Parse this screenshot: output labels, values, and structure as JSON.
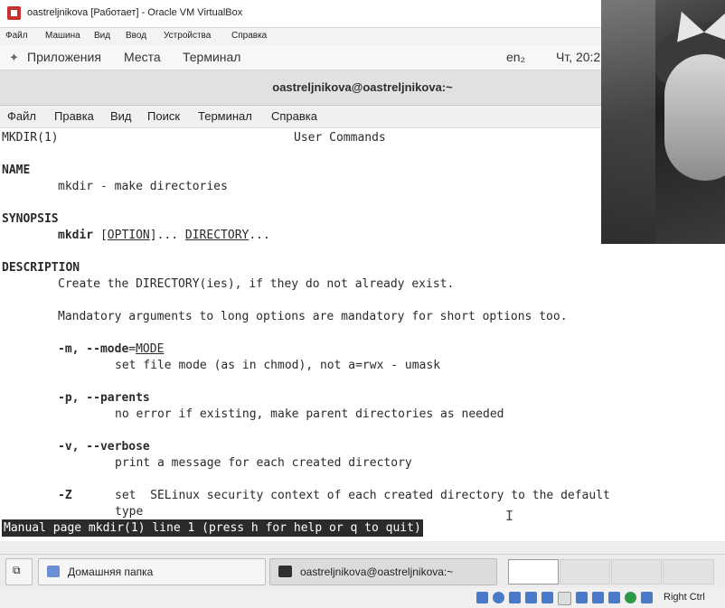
{
  "vbox": {
    "title": "oastreljnikova [Работает] - Oracle VM VirtualBox",
    "menu": [
      "Файл",
      "Машина",
      "Вид",
      "Ввод",
      "Устройства",
      "Справка"
    ],
    "host_key": "Right Ctrl"
  },
  "panel": {
    "apps": "Приложения",
    "places": "Места",
    "terminal": "Терминал",
    "keyboard": "en₂",
    "clock": "Чт, 20:2"
  },
  "terminal": {
    "title": "oastreljnikova@oastreljnikova:~",
    "menu": [
      "Файл",
      "Правка",
      "Вид",
      "Поиск",
      "Терминал",
      "Справка"
    ],
    "status": "Manual page mkdir(1) line 1 (press h for help or q to quit)"
  },
  "man": {
    "header_left": "MKDIR(1)",
    "header_center": "User Commands",
    "name_heading": "NAME",
    "name_text": "mkdir - make directories",
    "synopsis_heading": "SYNOPSIS",
    "syn_cmd": "mkdir",
    "syn_option": "OPTION",
    "syn_dir": "DIRECTORY",
    "description_heading": "DESCRIPTION",
    "desc1": "Create the DIRECTORY(ies), if they do not already exist.",
    "desc2": "Mandatory arguments to long options are mandatory for short options too.",
    "opt_m": "-m, --mode",
    "opt_m_arg": "MODE",
    "opt_m_desc": "set file mode (as in chmod), not a=rwx - umask",
    "opt_p": "-p, --parents",
    "opt_p_desc": "no error if existing, make parent directories as needed",
    "opt_v": "-v, --verbose",
    "opt_v_desc": "print a message for each created directory",
    "opt_z": "-Z",
    "opt_z_desc": "set  SELinux security context of each created directory to the default",
    "opt_z_desc2": "type"
  },
  "taskbar": {
    "home": "Домашняя папка",
    "terminal": "oastreljnikova@oastreljnikova:~"
  }
}
